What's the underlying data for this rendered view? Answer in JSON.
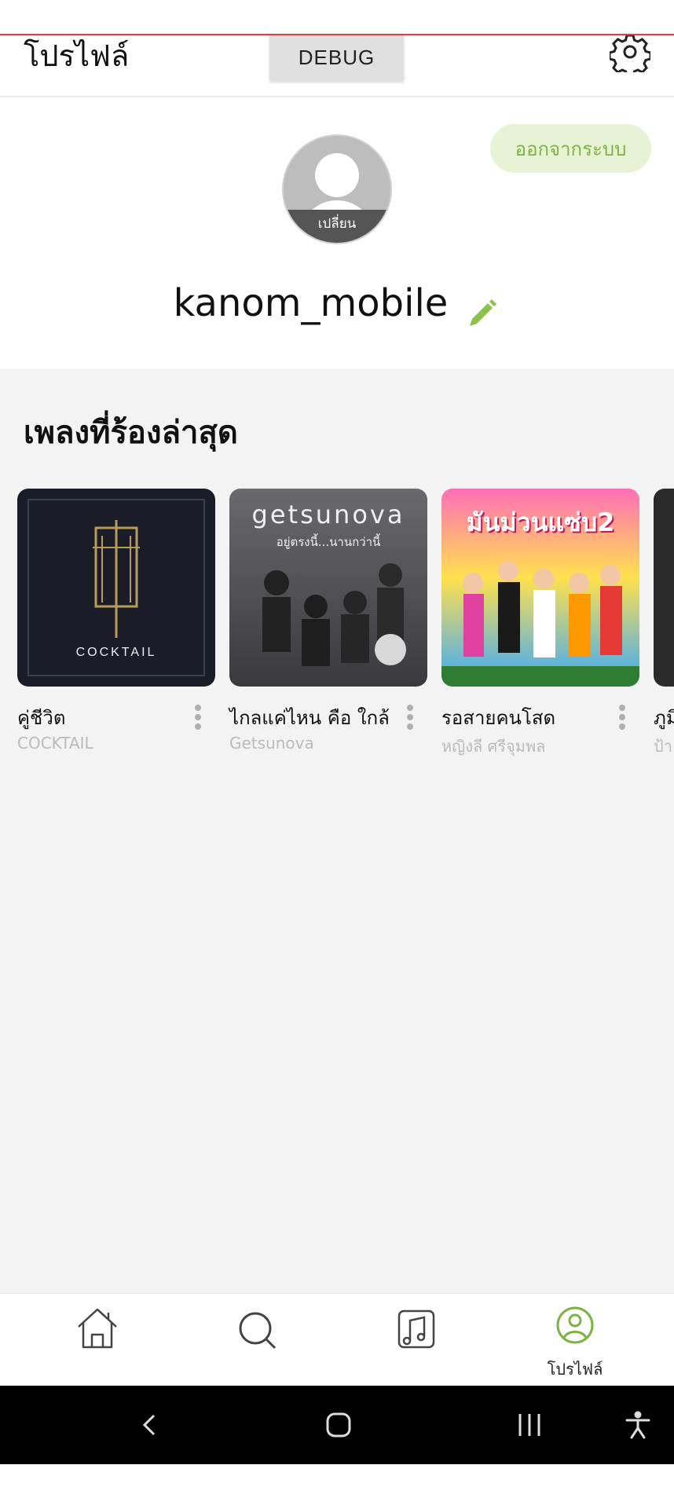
{
  "header": {
    "title": "โปรไฟล์",
    "debug_label": "DEBUG"
  },
  "profile": {
    "logout_label": "ออกจากระบบ",
    "avatar_change_label": "เปลี่ยน",
    "username": "kanom_mobile"
  },
  "recent": {
    "title": "เพลงที่ร้องล่าสุด",
    "songs": [
      {
        "title": "คู่ชีวิต",
        "artist": "COCKTAIL",
        "cover_text": "COCKTAIL"
      },
      {
        "title": "ไกลแค่ไหน คือ ใกล้",
        "artist": "Getsunova",
        "cover_text": "getsunova",
        "cover_subtext": "อยู่ตรงนี้...นานกว่านี้"
      },
      {
        "title": "รอสายคนโสด",
        "artist": "หญิงลี ศรีจุมพล",
        "cover_text": "มันม่วนแซ่บ2"
      },
      {
        "title": "ภูมิ",
        "artist": "ป้า"
      }
    ]
  },
  "bottom_nav": {
    "items": [
      {
        "icon": "home-icon"
      },
      {
        "icon": "search-icon"
      },
      {
        "icon": "music-note-icon"
      },
      {
        "icon": "profile-icon",
        "label": "โปรไฟล์"
      }
    ],
    "accent": "#7cb342"
  },
  "colors": {
    "accent_green": "#8bc34a",
    "logout_bg": "#e8f3d6"
  }
}
